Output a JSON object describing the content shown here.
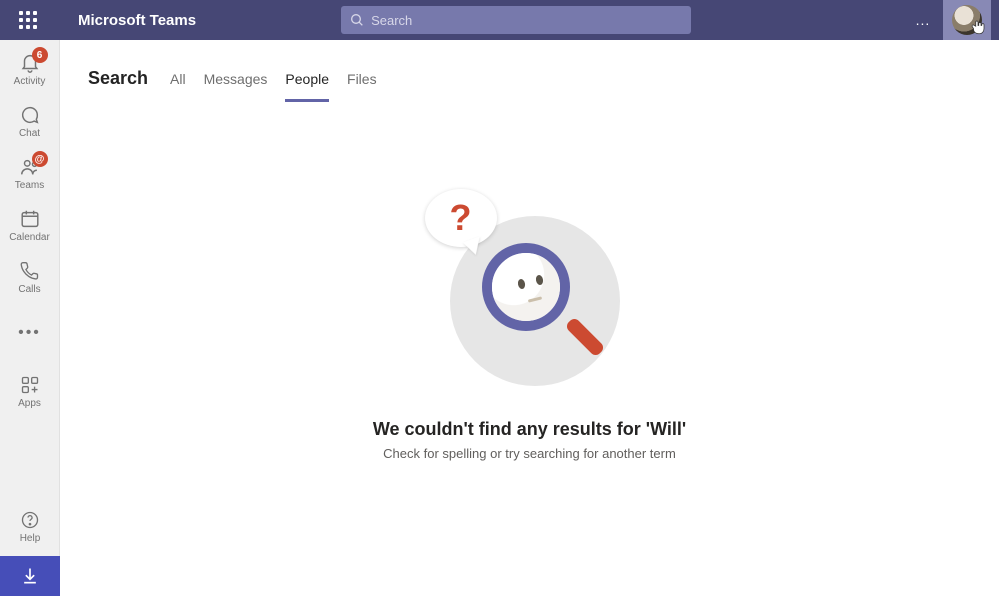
{
  "header": {
    "app_title": "Microsoft Teams",
    "search_placeholder": "Search",
    "more_label": "..."
  },
  "nav": {
    "activity": {
      "label": "Activity",
      "badge": "6"
    },
    "chat": {
      "label": "Chat"
    },
    "teams": {
      "label": "Teams",
      "badge": "@"
    },
    "calendar": {
      "label": "Calendar"
    },
    "calls": {
      "label": "Calls"
    },
    "apps": {
      "label": "Apps"
    },
    "help": {
      "label": "Help"
    }
  },
  "page": {
    "title": "Search",
    "tabs": [
      "All",
      "Messages",
      "People",
      "Files"
    ],
    "active_tab_index": 2
  },
  "empty_state": {
    "title": "We couldn't find any results for 'Will'",
    "subtitle": "Check for spelling or try searching for another term",
    "question_mark": "?"
  }
}
